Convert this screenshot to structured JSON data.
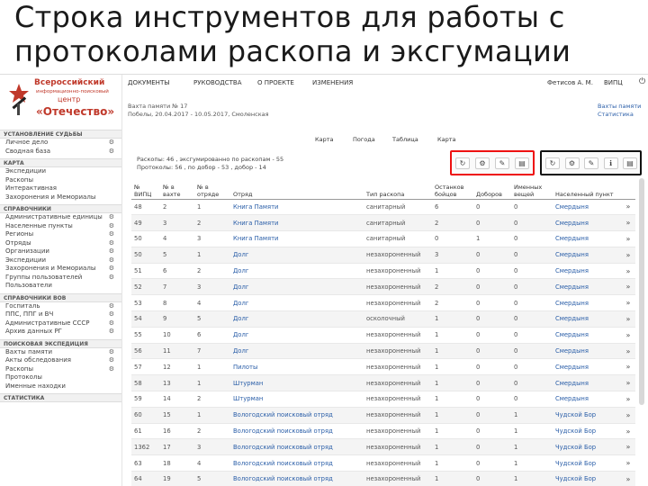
{
  "slide_title": "Строка инструментов для работы с протоколами раскопа и эксгумации",
  "logo": {
    "line1": "Всероссийский",
    "line2": "информационно-поисковый",
    "line3": "центр",
    "line4": "«Отечество»"
  },
  "sidebar": [
    {
      "heading": "УСТАНОВЛЕНИЕ СУДЬБЫ",
      "items": [
        {
          "label": "Личное дело",
          "gear": true
        },
        {
          "label": "Сводная база",
          "gear": true
        }
      ]
    },
    {
      "heading": "КАРТА",
      "items": [
        {
          "label": "Экспедиции",
          "gear": false
        },
        {
          "label": "Раскопы",
          "gear": false
        },
        {
          "label": "Интерактивная",
          "gear": false
        },
        {
          "label": "Захоронения и Мемориалы",
          "gear": false
        }
      ]
    },
    {
      "heading": "СПРАВОЧНИКИ",
      "items": [
        {
          "label": "Административные единицы",
          "gear": true
        },
        {
          "label": "Населенные пункты",
          "gear": true
        },
        {
          "label": "Регионы",
          "gear": true
        },
        {
          "label": "Отряды",
          "gear": true
        },
        {
          "label": "Организации",
          "gear": true
        },
        {
          "label": "Экспедиции",
          "gear": true
        },
        {
          "label": "Захоронения и Мемориалы",
          "gear": true
        },
        {
          "label": "Группы пользователей",
          "gear": true
        },
        {
          "label": "Пользователи",
          "gear": false
        }
      ]
    },
    {
      "heading": "СПРАВОЧНИКИ ВОВ",
      "items": [
        {
          "label": "Госпиталь",
          "gear": true
        },
        {
          "label": "ППС, ППГ и ВЧ",
          "gear": true
        },
        {
          "label": "Административные СССР",
          "gear": true
        },
        {
          "label": "Архив данных РГ",
          "gear": true
        }
      ]
    },
    {
      "heading": "ПОИСКОВАЯ ЭКСПЕДИЦИЯ",
      "items": [
        {
          "label": "Вахты памяти",
          "gear": true
        },
        {
          "label": "Акты обследования",
          "gear": true
        },
        {
          "label": "Раскопы",
          "gear": true
        },
        {
          "label": "Протоколы",
          "gear": false
        },
        {
          "label": "Именные находки",
          "gear": false
        }
      ]
    },
    {
      "heading": "СТАТИСТИКА",
      "items": []
    }
  ],
  "topnav": {
    "items": [
      "ДОКУМЕНТЫ",
      "РУКОВОДСТВА",
      "О ПРОЕКТЕ",
      "ИЗМЕНЕНИЯ"
    ],
    "user": "Фетисов А. М.",
    "org": "ВИПЦ",
    "power_icon": "⏻"
  },
  "header": {
    "line1": "Вахта памяти № 17",
    "line2": "Побелы, 20.04.2017 - 10.05.2017, Смоленская",
    "right1": "Вахты памяти",
    "right2": "Статистика"
  },
  "view_tabs": [
    "Карта",
    "Погода",
    "Таблица",
    "Карта"
  ],
  "stats": {
    "line1": "Раскопы: 46 , эксгумированно по раскопам - 55",
    "line2": "Протоколы: 56 , по добор - 53 , добор - 14"
  },
  "toolbar_red": [
    {
      "icon": "refresh-icon",
      "glyph": "↻"
    },
    {
      "icon": "gear-icon",
      "glyph": "⚙"
    },
    {
      "icon": "edit-icon",
      "glyph": "✎"
    },
    {
      "icon": "image-icon",
      "glyph": "▤"
    }
  ],
  "toolbar_black": [
    {
      "icon": "refresh-icon",
      "glyph": "↻"
    },
    {
      "icon": "gear-icon",
      "glyph": "⚙"
    },
    {
      "icon": "edit-icon",
      "glyph": "✎"
    },
    {
      "icon": "info-icon",
      "glyph": "ℹ"
    },
    {
      "icon": "image-icon",
      "glyph": "▤"
    }
  ],
  "table": {
    "headers": [
      "№ ВИПЦ",
      "№ в вахте",
      "№ в отряде",
      "Отряд",
      "Тип раскопа",
      "Останков бойцов",
      "Доборов",
      "Именных вещей",
      "Населенный пункт",
      ""
    ],
    "rows": [
      [
        "48",
        "2",
        "1",
        "Книга Памяти",
        "санитарный",
        "6",
        "0",
        "0",
        "Смердыня",
        "»"
      ],
      [
        "49",
        "3",
        "2",
        "Книга Памяти",
        "санитарный",
        "2",
        "0",
        "0",
        "Смердыня",
        "»"
      ],
      [
        "50",
        "4",
        "3",
        "Книга Памяти",
        "санитарный",
        "0",
        "1",
        "0",
        "Смердыня",
        "»"
      ],
      [
        "50",
        "5",
        "1",
        "Долг",
        "незахороненный",
        "3",
        "0",
        "0",
        "Смердыня",
        "»"
      ],
      [
        "51",
        "6",
        "2",
        "Долг",
        "незахороненный",
        "1",
        "0",
        "0",
        "Смердыня",
        "»"
      ],
      [
        "52",
        "7",
        "3",
        "Долг",
        "незахороненный",
        "2",
        "0",
        "0",
        "Смердыня",
        "»"
      ],
      [
        "53",
        "8",
        "4",
        "Долг",
        "незахороненный",
        "2",
        "0",
        "0",
        "Смердыня",
        "»"
      ],
      [
        "54",
        "9",
        "5",
        "Долг",
        "осколочный",
        "1",
        "0",
        "0",
        "Смердыня",
        "»"
      ],
      [
        "55",
        "10",
        "6",
        "Долг",
        "незахороненный",
        "1",
        "0",
        "0",
        "Смердыня",
        "»"
      ],
      [
        "56",
        "11",
        "7",
        "Долг",
        "незахороненный",
        "1",
        "0",
        "0",
        "Смердыня",
        "»"
      ],
      [
        "57",
        "12",
        "1",
        "Пилоты",
        "незахороненный",
        "1",
        "0",
        "0",
        "Смердыня",
        "»"
      ],
      [
        "58",
        "13",
        "1",
        "Штурман",
        "незахороненный",
        "1",
        "0",
        "0",
        "Смердыня",
        "»"
      ],
      [
        "59",
        "14",
        "2",
        "Штурман",
        "незахороненный",
        "1",
        "0",
        "0",
        "Смердыня",
        "»"
      ],
      [
        "60",
        "15",
        "1",
        "Вологодский поисковый отряд",
        "незахороненный",
        "1",
        "0",
        "1",
        "Чудской Бор",
        "»"
      ],
      [
        "61",
        "16",
        "2",
        "Вологодский поисковый отряд",
        "незахороненный",
        "1",
        "0",
        "1",
        "Чудской Бор",
        "»"
      ],
      [
        "1362",
        "17",
        "3",
        "Вологодский поисковый отряд",
        "незахороненный",
        "1",
        "0",
        "1",
        "Чудской Бор",
        "»"
      ],
      [
        "63",
        "18",
        "4",
        "Вологодский поисковый отряд",
        "незахороненный",
        "1",
        "0",
        "1",
        "Чудской Бор",
        "»"
      ],
      [
        "64",
        "19",
        "5",
        "Вологодский поисковый отряд",
        "незахороненный",
        "1",
        "0",
        "1",
        "Чудской Бор",
        "»"
      ]
    ]
  }
}
